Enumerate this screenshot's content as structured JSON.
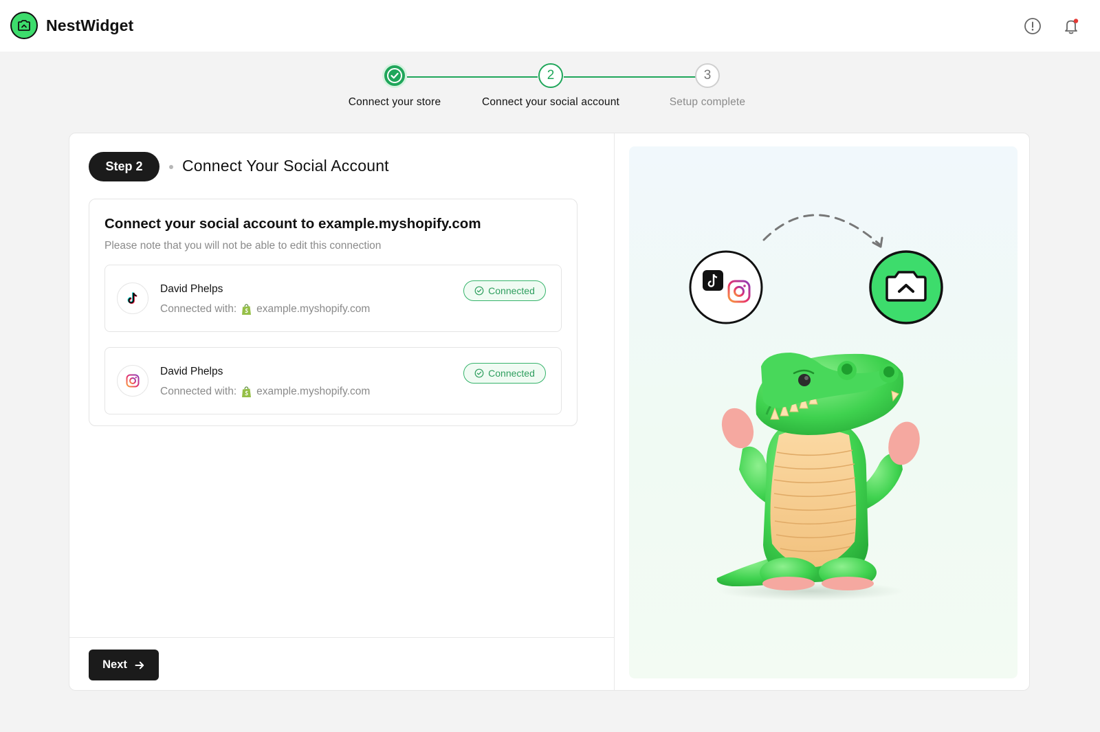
{
  "header": {
    "brand_name": "NestWidget",
    "icons": [
      "info-icon",
      "notification-bell-icon"
    ],
    "notification_dot_color": "#e53935"
  },
  "stepper": {
    "steps": [
      {
        "label": "Connect your store",
        "number": "1",
        "state": "completed"
      },
      {
        "label": "Connect your social account",
        "number": "2",
        "state": "active"
      },
      {
        "label": "Setup complete",
        "number": "3",
        "state": "upcoming"
      }
    ],
    "accent_color": "#1fa65a"
  },
  "panel": {
    "step_badge": "Step 2",
    "title": "Connect Your Social Account",
    "card_heading": "Connect your social account to example.myshopify.com",
    "card_note": "Please note that you will not be able to edit this connection",
    "accounts": [
      {
        "platform_icon": "tiktok-icon",
        "name": "David Phelps",
        "connected_with_label": "Connected with:",
        "store_icon": "shopify-icon",
        "store": "example.myshopify.com",
        "status": "Connected"
      },
      {
        "platform_icon": "instagram-icon",
        "name": "David Phelps",
        "connected_with_label": "Connected with:",
        "store_icon": "shopify-icon",
        "store": "example.myshopify.com",
        "status": "Connected"
      }
    ],
    "next_label": "Next"
  },
  "illustration": {
    "elements": [
      "tiktok-icon",
      "instagram-icon",
      "nestwidget-logo",
      "dashed-arrow",
      "crocodile-mascot"
    ],
    "brand_green": "#3ddc6c"
  }
}
